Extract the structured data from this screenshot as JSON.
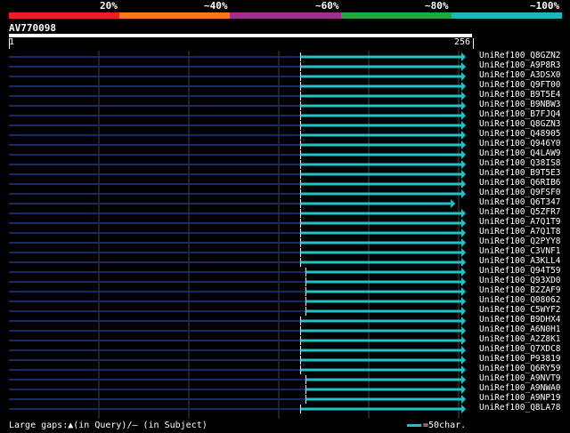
{
  "legend": {
    "colors": [
      "#ee1c25",
      "#f47920",
      "#9d2f92",
      "#22a73a",
      "#1fb5bf"
    ],
    "labels": [
      "20%",
      "~40%",
      "~60%",
      "~80%",
      "~100%"
    ]
  },
  "query": {
    "name": "AV770098",
    "start": "1",
    "end": "256"
  },
  "hit_color": "#1fc4c8",
  "gap_color": "#1a2a66",
  "hits": [
    {
      "label": "UniRef100_Q8GZN2",
      "start": 165
    },
    {
      "label": "UniRef100_A9P8R3",
      "start": 165
    },
    {
      "label": "UniRef100_A3DSX0",
      "start": 165
    },
    {
      "label": "UniRef100_Q9FT00",
      "start": 165
    },
    {
      "label": "UniRef100_B9T5E4",
      "start": 165
    },
    {
      "label": "UniRef100_B9NBW3",
      "start": 165
    },
    {
      "label": "UniRef100_B7FJQ4",
      "start": 165
    },
    {
      "label": "UniRef100_Q8GZN3",
      "start": 165
    },
    {
      "label": "UniRef100_Q48905",
      "start": 165
    },
    {
      "label": "UniRef100_Q946Y0",
      "start": 165
    },
    {
      "label": "UniRef100_Q4LAW9",
      "start": 165
    },
    {
      "label": "UniRef100_Q38IS8",
      "start": 165
    },
    {
      "label": "UniRef100_B9T5E3",
      "start": 165
    },
    {
      "label": "UniRef100_Q6RIB6",
      "start": 165
    },
    {
      "label": "UniRef100_Q9FSF0",
      "start": 165
    },
    {
      "label": "UniRef100_Q6T347",
      "start": 165,
      "end": 250
    },
    {
      "label": "UniRef100_Q5ZFR7",
      "start": 165
    },
    {
      "label": "UniRef100_A7Q1T9",
      "start": 165
    },
    {
      "label": "UniRef100_A7Q1T8",
      "start": 165
    },
    {
      "label": "UniRef100_Q2PYY8",
      "start": 165
    },
    {
      "label": "UniRef100_C3VNF1",
      "start": 165
    },
    {
      "label": "UniRef100_A3KLL4",
      "start": 165
    },
    {
      "label": "UniRef100_Q94T59",
      "start": 168
    },
    {
      "label": "UniRef100_Q93XD0",
      "start": 168
    },
    {
      "label": "UniRef100_B2ZAF9",
      "start": 168
    },
    {
      "label": "UniRef100_Q08062",
      "start": 168
    },
    {
      "label": "UniRef100_C5WYF2",
      "start": 168
    },
    {
      "label": "UniRef100_B9DHX4",
      "start": 165
    },
    {
      "label": "UniRef100_A6N0H1",
      "start": 165
    },
    {
      "label": "UniRef100_A2Z8K1",
      "start": 165
    },
    {
      "label": "UniRef100_Q7XDC8",
      "start": 165
    },
    {
      "label": "UniRef100_P93819",
      "start": 165
    },
    {
      "label": "UniRef100_Q6RY59",
      "start": 165
    },
    {
      "label": "UniRef100_A9NVT9",
      "start": 168
    },
    {
      "label": "UniRef100_A9NWA0",
      "start": 168
    },
    {
      "label": "UniRef100_A9NP19",
      "start": 168
    },
    {
      "label": "UniRef100_Q8LA78",
      "start": 165
    }
  ],
  "footer": {
    "gaps_text": "Large gaps:▲(in Query)/– (in Subject)",
    "scale_text": "=50char."
  }
}
